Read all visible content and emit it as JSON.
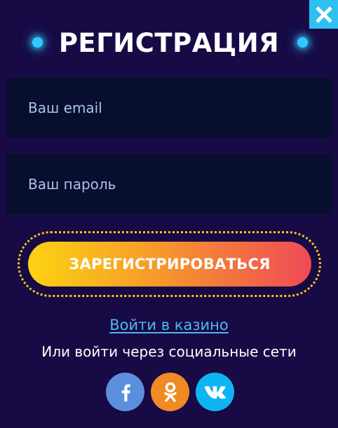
{
  "modal": {
    "title": "РЕГИСТРАЦИЯ",
    "close_icon": "close-icon"
  },
  "form": {
    "email_placeholder": "Ваш email",
    "password_placeholder": "Ваш пароль",
    "register_label": "ЗАРЕГИСТРИРОВАТЬСЯ"
  },
  "links": {
    "login_label": "Войти в казино",
    "social_label": "Или войти через социальные сети"
  },
  "social": [
    {
      "name": "facebook",
      "icon": "facebook-icon",
      "color": "#5b8fdc"
    },
    {
      "name": "odnoklassniki",
      "icon": "odnoklassniki-icon",
      "color": "#f08a24"
    },
    {
      "name": "vkontakte",
      "icon": "vk-icon",
      "color": "#0fb4f2"
    }
  ],
  "colors": {
    "background": "#170a45",
    "field_bg": "#080f2e",
    "accent": "#2fc0f2",
    "link": "#4fb8f0",
    "button_gradient_start": "#fdd212",
    "button_gradient_end": "#ef4a56"
  }
}
